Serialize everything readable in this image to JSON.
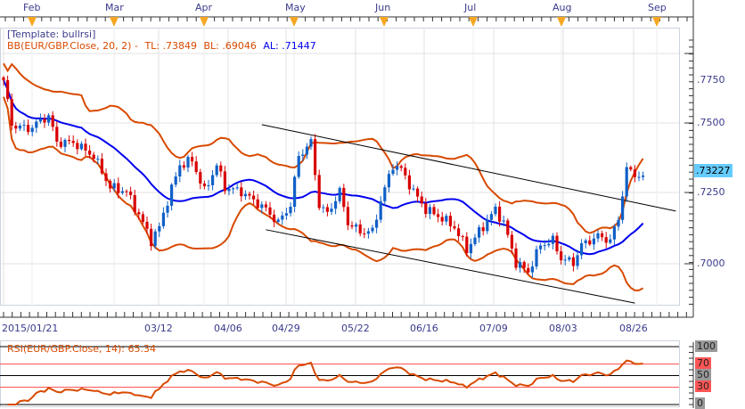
{
  "months": [
    "Feb",
    "Mar",
    "Apr",
    "May",
    "Jun",
    "Jul",
    "Aug",
    "Sep"
  ],
  "dates": [
    "2015/01/21",
    "03/12",
    "04/06",
    "04/29",
    "05/22",
    "06/16",
    "07/09",
    "08/03",
    "08/26"
  ],
  "legend": {
    "template": "[Template: bullrsi]",
    "bb": "BB(EUR/GBP.Close, 20, 2) -",
    "tl": "TL: .73849",
    "bl": "BL: .69046",
    "al": "AL: .71447",
    "rsi": "RSI(EUR/GBP.Close, 14): 65.34"
  },
  "price_axis": [
    ".7750",
    ".7500",
    ".7250",
    ".7000"
  ],
  "current_price": ".73227",
  "rsi_axis": [
    "100",
    "70",
    "50",
    "30",
    "0"
  ],
  "colors": {
    "up": "#1060c8",
    "down": "#d80000",
    "bb": "#d84a00",
    "ma": "#0000ee",
    "current": "#66ccff",
    "rsi_level": "#ff5555"
  },
  "chart_data": {
    "type": "candlestick",
    "symbol": "EUR/GBP",
    "price_range": [
      0.688,
      0.785
    ],
    "close_path": [
      [
        0,
        0.7654
      ],
      [
        2,
        0.7494
      ],
      [
        6,
        0.7478
      ],
      [
        11,
        0.7526
      ],
      [
        13,
        0.743
      ],
      [
        17,
        0.743
      ],
      [
        22,
        0.7381
      ],
      [
        26,
        0.7269
      ],
      [
        30,
        0.7253
      ],
      [
        34,
        0.7141
      ],
      [
        36,
        0.7077
      ],
      [
        38,
        0.7125
      ],
      [
        40,
        0.7221
      ],
      [
        43,
        0.7349
      ],
      [
        46,
        0.7365
      ],
      [
        49,
        0.7253
      ],
      [
        52,
        0.7349
      ],
      [
        54,
        0.7269
      ],
      [
        58,
        0.7253
      ],
      [
        61,
        0.7221
      ],
      [
        64,
        0.7189
      ],
      [
        67,
        0.7141
      ],
      [
        70,
        0.7205
      ],
      [
        72,
        0.7381
      ],
      [
        75,
        0.743
      ],
      [
        77,
        0.7205
      ],
      [
        79,
        0.7173
      ],
      [
        82,
        0.7253
      ],
      [
        84,
        0.7141
      ],
      [
        87,
        0.7109
      ],
      [
        90,
        0.7109
      ],
      [
        92,
        0.7221
      ],
      [
        95,
        0.7349
      ],
      [
        97,
        0.7333
      ],
      [
        100,
        0.7253
      ],
      [
        103,
        0.7189
      ],
      [
        107,
        0.7157
      ],
      [
        110,
        0.7125
      ],
      [
        113,
        0.7045
      ],
      [
        116,
        0.7109
      ],
      [
        120,
        0.7189
      ],
      [
        122,
        0.7141
      ],
      [
        125,
        0.6997
      ],
      [
        128,
        0.6965
      ],
      [
        131,
        0.7061
      ],
      [
        134,
        0.7077
      ],
      [
        136,
        0.7013
      ],
      [
        139,
        0.6997
      ],
      [
        141,
        0.7061
      ],
      [
        145,
        0.7093
      ],
      [
        148,
        0.7077
      ],
      [
        150,
        0.7157
      ],
      [
        152,
        0.7333
      ],
      [
        154,
        0.7317
      ],
      [
        156,
        0.7301
      ]
    ],
    "trendlines": [
      [
        [
          63,
          0.7494
        ],
        [
          164,
          0.7183
        ]
      ],
      [
        [
          64,
          0.7116
        ],
        [
          154,
          0.6852
        ]
      ]
    ],
    "bollinger": {
      "period": 20,
      "stddev": 2
    },
    "rsi": {
      "period": 14,
      "levels": [
        30,
        50,
        70
      ],
      "value": 65.34
    }
  }
}
